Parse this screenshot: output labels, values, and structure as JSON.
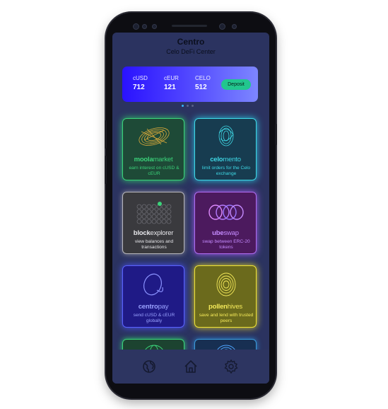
{
  "app": {
    "title": "Centro",
    "subtitle": "Celo DeFi Center"
  },
  "balances": [
    {
      "currency": "cUSD",
      "amount": "712"
    },
    {
      "currency": "cEUR",
      "amount": "121"
    },
    {
      "currency": "CELO",
      "amount": "512"
    }
  ],
  "deposit_label": "Deposit",
  "carousel": {
    "pages": 3,
    "active": 0
  },
  "tiles": [
    {
      "name_bold": "moola",
      "name_rest": "market",
      "desc": "earn interest on cUSD & cEUR",
      "color": "#3bd37a"
    },
    {
      "name_bold": "celo",
      "name_rest": "mento",
      "desc": "limit orders for the Celo exchange",
      "color": "#3fd9e6"
    },
    {
      "name_bold": "block",
      "name_rest": "explorer",
      "desc": "view balances and transactions",
      "color": "#e6e6ea"
    },
    {
      "name_bold": "ube",
      "name_rest": "swap",
      "desc": "swap between ERC-20 tokens",
      "color": "#c58bff"
    },
    {
      "name_bold": "centro",
      "name_rest": "pay",
      "desc": "send cUSD & cEUR globally",
      "color": "#8a92ff"
    },
    {
      "name_bold": "pollen",
      "name_rest": "hives",
      "desc": "save and lend with trusted peers",
      "color": "#f5ea5a"
    }
  ],
  "nav": {
    "items": [
      "globe-icon",
      "home-icon",
      "settings-icon"
    ],
    "active": "home-icon"
  }
}
